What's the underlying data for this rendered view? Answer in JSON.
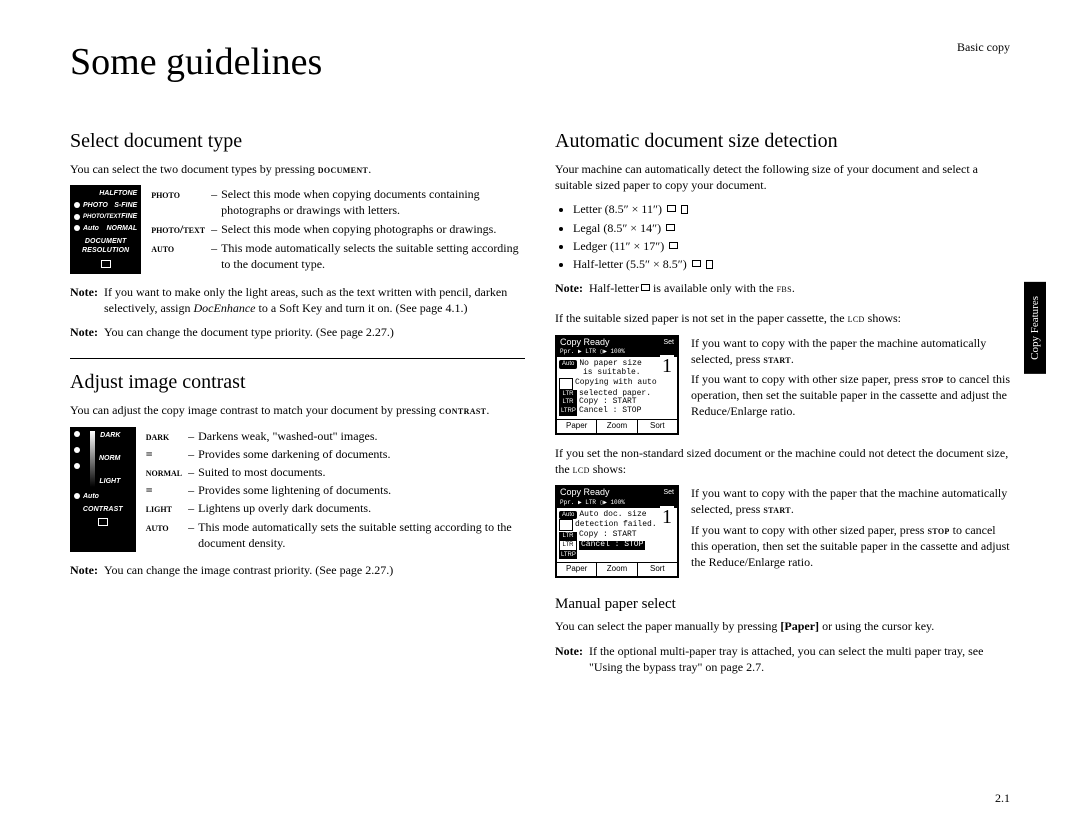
{
  "header": {
    "section": "Basic copy"
  },
  "title": "Some guidelines",
  "side_tab": "Copy Features",
  "page_number": "2.1",
  "left": {
    "section1": {
      "heading": "Select document type",
      "intro_pre": "You can select the two document types by pressing ",
      "intro_key": "document",
      "intro_post": ".",
      "panel": {
        "rows": [
          [
            "HALFTONE"
          ],
          [
            "PHOTO",
            "S-FINE"
          ],
          [
            "PHOTO/TEXT",
            "FINE"
          ],
          [
            "Auto",
            "NORMAL"
          ]
        ],
        "footer": "DOCUMENT  RESOLUTION"
      },
      "defs": [
        {
          "k": "photo",
          "v": "Select this mode when copying documents containing photographs or drawings with letters."
        },
        {
          "k": "photo/text",
          "v": "Select this mode when copying photographs or drawings."
        },
        {
          "k": "auto",
          "v": "This mode automatically selects the suitable setting according to the document type."
        }
      ],
      "note1_pre": "If you want to make only the light areas, such as the text written with pencil, darken selectively, assign ",
      "note1_em": "DocEnhance",
      "note1_post": " to a Soft Key and turn it on. (See page 4.1.)",
      "note2": "You can change the document type priority. (See page 2.27.)"
    },
    "section2": {
      "heading": "Adjust image contrast",
      "intro_pre": "You can adjust the copy image contrast to match your document by pressing ",
      "intro_key": "contrast",
      "intro_post": ".",
      "panel": {
        "labels": [
          "DARK",
          "NORM",
          "LIGHT"
        ],
        "auto": "Auto",
        "footer": "CONTRAST"
      },
      "defs": [
        {
          "k": "dark",
          "v": "Darkens weak, \"washed-out\" images."
        },
        {
          "k": "=",
          "v": "Provides some darkening of documents."
        },
        {
          "k": "normal",
          "v": "Suited to most documents."
        },
        {
          "k": "=",
          "v": "Provides some lightening of documents."
        },
        {
          "k": "light",
          "v": "Lightens up overly dark documents."
        },
        {
          "k": "auto",
          "v": "This mode automatically sets the suitable setting according to the document density."
        }
      ],
      "note": "You can change the image contrast priority. (See page 2.27.)"
    }
  },
  "right": {
    "section1": {
      "heading": "Automatic document size detection",
      "intro": "Your machine can automatically detect the following size of your document and select a suitable sized paper to copy your document.",
      "sizes": [
        "Letter (8.5″ × 11″)",
        "Legal (8.5″ × 14″)",
        "Ledger (11″ × 17″)",
        "Half-letter (5.5″ × 8.5″)"
      ],
      "size_orients": [
        "lp",
        "l",
        "l",
        "lp"
      ],
      "note1_pre": "Half-letter",
      "note1_post": " is available only with the ",
      "note1_key": "fbs",
      "note1_end": ".",
      "para_cassette_pre": "If the suitable sized paper is not set in the paper cassette, the ",
      "para_cassette_key": "lcd",
      "para_cassette_post": " shows:",
      "lcd1": {
        "title_l": "Copy",
        "title_r": "Ready",
        "set": "Set",
        "bar": "Ppr. ▶ LTR    ▯▶ 100%",
        "big": "1",
        "auto": "Auto",
        "lines": [
          "No paper size",
          "is suitable.",
          "Copying with auto",
          "selected paper.",
          "Copy   : START",
          "Cancel : STOP"
        ],
        "sidebars": [
          "LTR",
          "LTR",
          "LTRP"
        ],
        "foot": [
          "Paper",
          "Zoom",
          "Sort"
        ]
      },
      "lcd1_text": [
        {
          "pre": "If you want to copy with the paper the machine automatically selected, press ",
          "key": "start",
          "post": "."
        },
        {
          "pre": "If you want to copy with other size paper, press ",
          "key": "stop",
          "post": " to cancel this operation, then set the suitable paper in the cassette and adjust the Reduce/Enlarge ratio."
        }
      ],
      "para_nonstd_pre": "If you set the non-standard sized document or the machine could not detect the document size, the ",
      "para_nonstd_key": "lcd",
      "para_nonstd_post": " shows:",
      "lcd2": {
        "title_l": "Copy",
        "title_r": "Ready",
        "set": "Set",
        "bar": "Ppr. ▶ LTR    ▯▶ 100%",
        "big": "1",
        "auto": "Auto",
        "lines": [
          "Auto doc. size",
          "detection failed.",
          "Copy   : START",
          "Cancel : STOP"
        ],
        "sidebars": [
          "LTR",
          "LTR",
          "LTRP"
        ],
        "foot": [
          "Paper",
          "Zoom",
          "Sort"
        ]
      },
      "lcd2_text": [
        {
          "pre": "If you want to copy with the paper that the machine automatically selected, press ",
          "key": "start",
          "post": "."
        },
        {
          "pre": "If you want to copy with other sized paper, press ",
          "key": "stop",
          "post": " to cancel this operation, then set the suitable paper in the cassette and adjust the Reduce/Enlarge ratio."
        }
      ]
    },
    "section2": {
      "heading": "Manual paper select",
      "intro_pre": "You can select the paper manually by pressing ",
      "intro_key": "[Paper]",
      "intro_post": " or using the cursor key.",
      "note": "If the optional multi-paper tray is attached, you can select the multi paper tray, see \"Using the bypass tray\" on page 2.7."
    }
  },
  "labels": {
    "note": "Note:"
  }
}
